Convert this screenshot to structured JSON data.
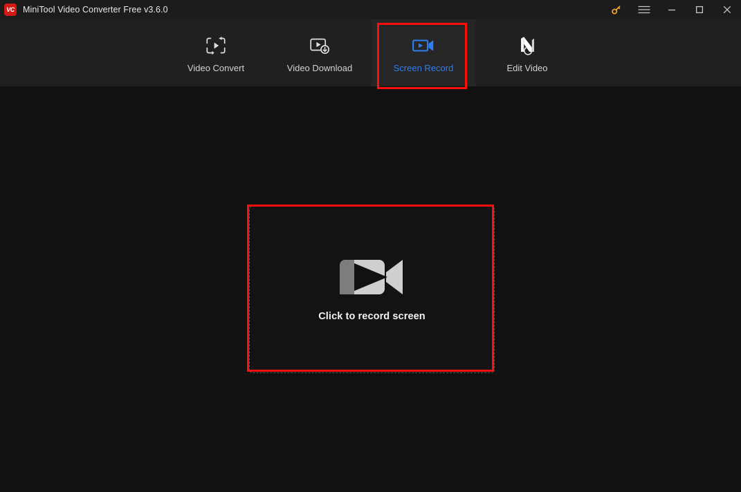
{
  "window": {
    "title": "MiniTool Video Converter Free v3.6.0",
    "logo_text": "VC",
    "logo_color": "#d11a14",
    "controls": [
      {
        "name": "register-key-icon",
        "label": "Register",
        "color": "#f0a524"
      },
      {
        "name": "menu-icon",
        "label": "Menu",
        "color": "#c8c8c8"
      },
      {
        "name": "minimize-icon",
        "label": "Minimize",
        "color": "#c8c8c8"
      },
      {
        "name": "maximize-icon",
        "label": "Maximize",
        "color": "#c8c8c8"
      },
      {
        "name": "close-icon",
        "label": "Close",
        "color": "#c8c8c8"
      }
    ]
  },
  "nav": {
    "active_index": 2,
    "active_color": "#2d7fef",
    "items": [
      {
        "label": "Video Convert",
        "icon": "video-convert-icon"
      },
      {
        "label": "Video Download",
        "icon": "video-download-icon"
      },
      {
        "label": "Screen Record",
        "icon": "screen-record-icon"
      },
      {
        "label": "Edit Video",
        "icon": "edit-video-icon"
      }
    ]
  },
  "main": {
    "dropzone": {
      "label": "Click to record screen",
      "icon": "camcorder-icon"
    }
  },
  "annotations": {
    "color": "#ff0d0d",
    "boxes": [
      {
        "name": "highlight-screen-record-tab",
        "target": "Screen Record"
      },
      {
        "name": "highlight-record-dropzone",
        "target": "Click to record screen"
      }
    ]
  }
}
